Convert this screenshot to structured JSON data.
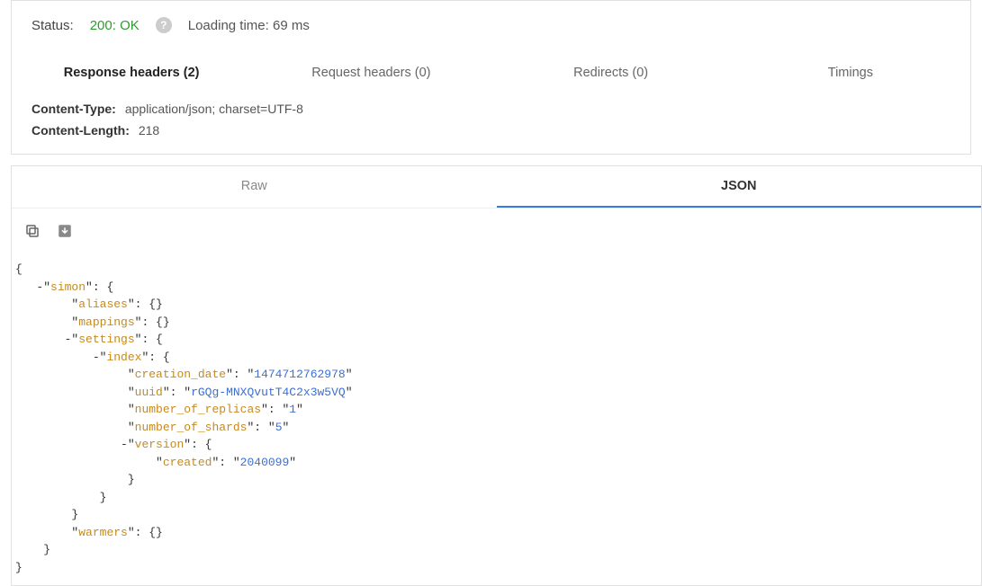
{
  "status": {
    "label": "Status:",
    "code": "200: OK",
    "loading_label": "Loading time: 69 ms"
  },
  "header_tabs": {
    "response": "Response headers (2)",
    "request": "Request headers (0)",
    "redirects": "Redirects (0)",
    "timings": "Timings"
  },
  "response_headers": [
    {
      "key": "Content-Type:",
      "value": "application/json; charset=UTF-8"
    },
    {
      "key": "Content-Length:",
      "value": "218"
    }
  ],
  "body_tabs": {
    "raw": "Raw",
    "json": "JSON"
  },
  "json_body": {
    "root_key": "simon",
    "aliases_key": "aliases",
    "mappings_key": "mappings",
    "settings_key": "settings",
    "index_key": "index",
    "creation_date_key": "creation_date",
    "creation_date_val": "1474712762978",
    "uuid_key": "uuid",
    "uuid_val": "rGQg-MNXQvutT4C2x3w5VQ",
    "replicas_key": "number_of_replicas",
    "replicas_val": "1",
    "shards_key": "number_of_shards",
    "shards_val": "5",
    "version_key": "version",
    "created_key": "created",
    "created_val": "2040099",
    "warmers_key": "warmers"
  }
}
